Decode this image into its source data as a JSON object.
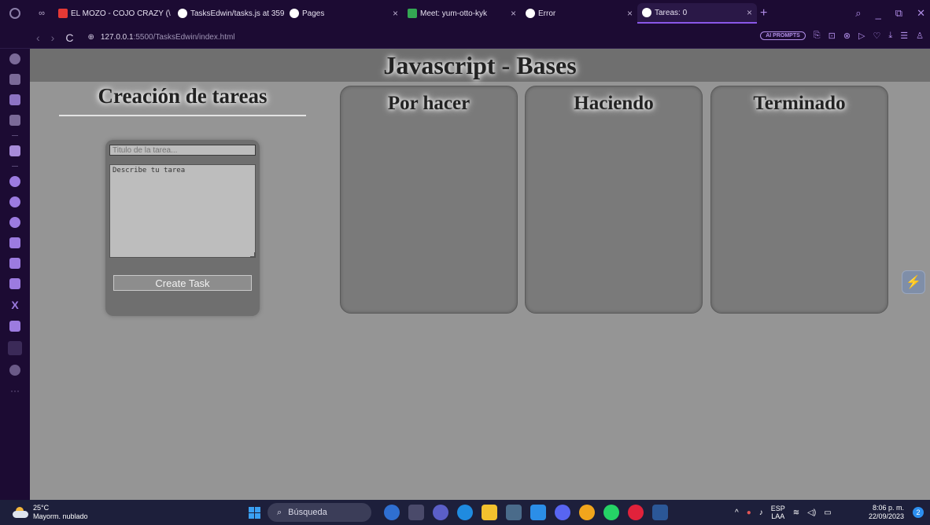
{
  "browser": {
    "tabs": [
      {
        "label": "EL MOZO - COJO CRAZY (\\",
        "favicon_color": "#e53935",
        "close": "×"
      },
      {
        "label": "TasksEdwin/tasks.js at 359",
        "favicon_color": "#ffffff",
        "close": "×"
      },
      {
        "label": "Pages",
        "favicon_color": "#ffffff",
        "close": "×"
      },
      {
        "label": "Meet: yum-otto-kyk",
        "favicon_color": "#34a853",
        "close": "×"
      },
      {
        "label": "Error",
        "favicon_color": "#ffffff",
        "close": "×"
      },
      {
        "label": "Tareas: 0",
        "favicon_color": "#ffffff",
        "close": "×",
        "active": true
      }
    ],
    "new_tab": "+",
    "window_controls": [
      "⌕",
      "_",
      "⧉",
      "✕"
    ],
    "nav": {
      "back": "‹",
      "forward": "›",
      "reload": "C"
    },
    "url_host": "127.0.0.1",
    "url_rest": ":5500/TasksEdwin/index.html",
    "ai_prompts": "AI PROMPTS",
    "toolbar_icons": [
      "⎘",
      "⊡",
      "⊗",
      "▷",
      "♡",
      "⤓",
      "☰",
      "♙"
    ]
  },
  "page": {
    "title": "Javascript - Bases",
    "create_section_title": "Creación de tareas",
    "form": {
      "title_placeholder": "Titulo de la tarea...",
      "description_value": "Describe tu tarea",
      "submit_label": "Create Task"
    },
    "columns": [
      {
        "title": "Por hacer"
      },
      {
        "title": "Haciendo"
      },
      {
        "title": "Terminado"
      }
    ],
    "extension_icon": "⚡"
  },
  "taskbar": {
    "temperature": "25°C",
    "weather_text": "Mayorm. nublado",
    "search_placeholder": "Búsqueda",
    "app_colors": [
      "#2f6fd1",
      "#4a4a6a",
      "#5b5fc7",
      "#1f8be0",
      "#f2c12e",
      "#4a6b8a",
      "#2b8ee8",
      "#5865f2",
      "#f1a51c",
      "#25d366",
      "#e1223b",
      "#2b5797"
    ],
    "lang_top": "ESP",
    "lang_bottom": "LAA",
    "time": "8:06 p. m.",
    "date": "22/09/2023",
    "notification_count": "2"
  }
}
